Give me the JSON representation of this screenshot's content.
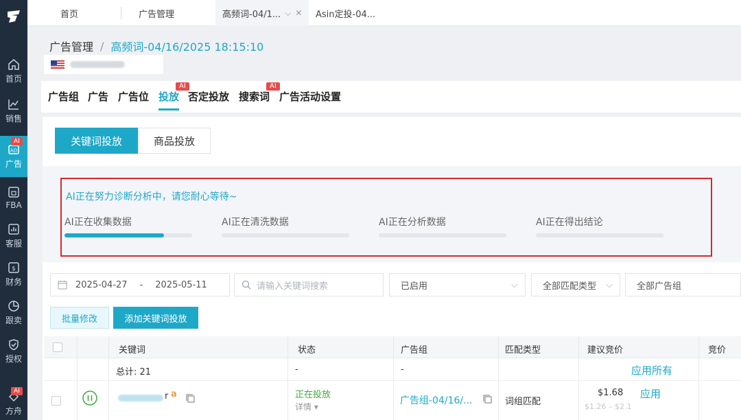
{
  "sidebar": {
    "items": [
      {
        "label": "首页",
        "icon": "home-icon"
      },
      {
        "label": "销售",
        "icon": "chart-line-icon"
      },
      {
        "label": "广告",
        "icon": "ad-icon",
        "badge": "AI"
      },
      {
        "label": "FBA",
        "icon": "warehouse-icon"
      },
      {
        "label": "客服",
        "icon": "service-icon"
      },
      {
        "label": "财务",
        "icon": "finance-icon"
      },
      {
        "label": "跟卖",
        "icon": "pie-icon"
      },
      {
        "label": "授权",
        "icon": "shield-icon"
      },
      {
        "label": "方舟",
        "icon": "ark-icon",
        "badge": "AI"
      }
    ]
  },
  "tabs": [
    {
      "label": "首页"
    },
    {
      "label": "广告管理"
    },
    {
      "label": "高频词-04/1..."
    },
    {
      "label": "Asin定投-04..."
    }
  ],
  "breadcrumb": {
    "root": "广告管理",
    "sep": "/",
    "current": "高频词-04/16/2025 18:15:10"
  },
  "main_tabs": [
    {
      "label": "广告组"
    },
    {
      "label": "广告"
    },
    {
      "label": "广告位"
    },
    {
      "label": "投放",
      "badge": "AI"
    },
    {
      "label": "否定投放"
    },
    {
      "label": "搜索词",
      "badge": "AI"
    },
    {
      "label": "广告活动设置"
    }
  ],
  "toggle": {
    "keyword": "关键词投放",
    "product": "商品投放"
  },
  "diagnosis": {
    "title": "AI正在努力诊断分析中，请您耐心等待~",
    "steps": [
      {
        "label": "AI正在收集数据",
        "progress": 0.78
      },
      {
        "label": "AI正在清洗数据",
        "progress": 0
      },
      {
        "label": "AI正在分析数据",
        "progress": 0
      },
      {
        "label": "AI正在得出结论",
        "progress": 0
      }
    ]
  },
  "filters": {
    "date_start": "2025-04-27",
    "date_sep": "-",
    "date_end": "2025-05-11",
    "search_placeholder": "请输入关键词搜索",
    "status": "已启用",
    "match_type": "全部匹配类型",
    "ad_group": "全部广告组"
  },
  "actions": {
    "batch": "批量修改",
    "add": "添加关键词投放"
  },
  "table": {
    "headers": [
      "关键词",
      "状态",
      "广告组",
      "匹配类型",
      "建议竞价",
      "竞价"
    ],
    "total": {
      "label": "总计: 21",
      "status": "-",
      "group": "-",
      "apply_all": "应用所有"
    },
    "rows": [
      {
        "keyword_suffix": "r",
        "status": "正在投放",
        "detail": "详情",
        "group": "广告组-04/16/...",
        "match": "词组匹配",
        "bid": "$1.68",
        "bid_range": "$1.26 – $2.1",
        "apply": "应用"
      }
    ]
  }
}
